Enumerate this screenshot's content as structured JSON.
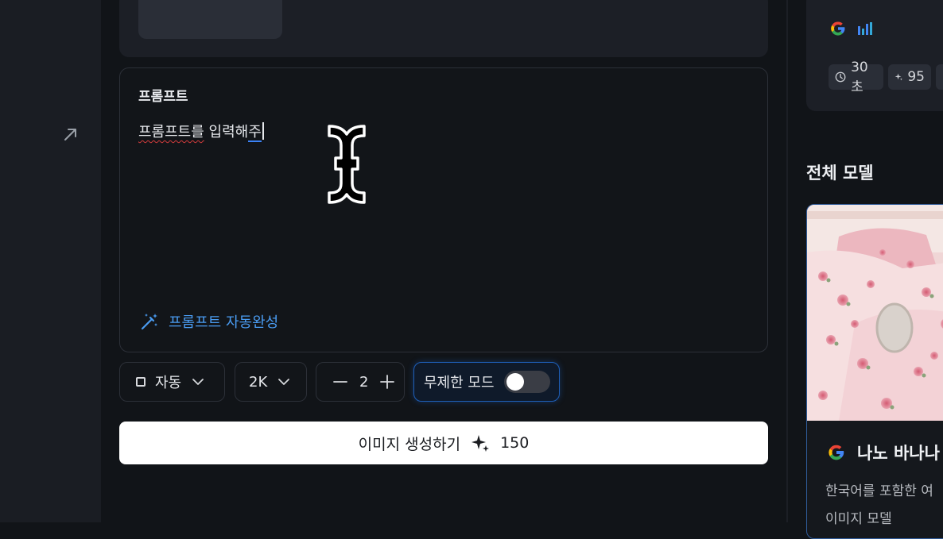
{
  "prompt": {
    "label": "프롬프트",
    "text_underlined": "프롬프트를",
    "text_middle": " 입력해",
    "text_last": "주",
    "autocomplete_label": "프롬프트 자동완성"
  },
  "controls": {
    "aspect_label": "자동",
    "resolution_label": "2K",
    "count_value": "2",
    "unlimited_label": "무제한 모드",
    "unlimited_enabled": false
  },
  "generate_button": {
    "label": "이미지 생성하기",
    "cost": "150"
  },
  "side_panel": {
    "time_label": "30초",
    "credit_label": "95",
    "all_models_title": "전체 모델",
    "featured_model": {
      "name": "나노 바나나",
      "description_line1": "한국어를 포함한 여",
      "description_line2": "이미지 모델"
    }
  },
  "colors": {
    "accent_blue": "#4a9cf2",
    "background": "#111418",
    "card": "#1c1f26"
  }
}
